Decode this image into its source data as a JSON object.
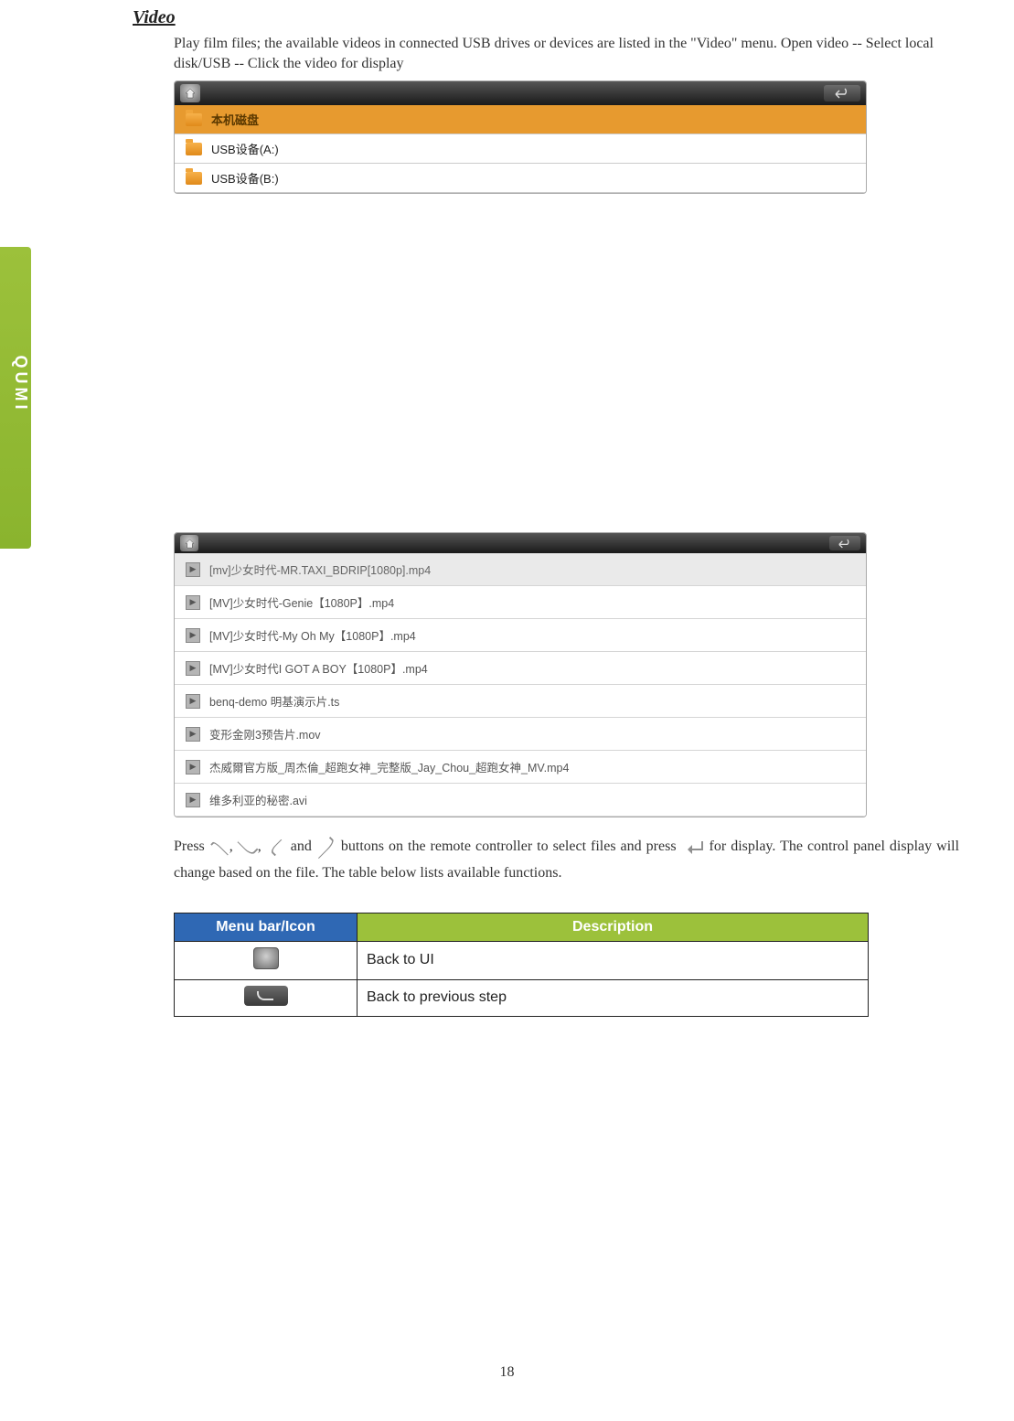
{
  "section_title": "Video",
  "intro": "Play film files; the available videos in connected USB drives or devices are listed in the \"Video\" menu. Open video -- Select local disk/USB -- Click the video for display",
  "browser1": {
    "items": [
      {
        "label": "本机磁盘",
        "selected": true
      },
      {
        "label": "USB设备(A:)",
        "selected": false
      },
      {
        "label": "USB设备(B:)",
        "selected": false
      }
    ]
  },
  "browser2": {
    "files": [
      {
        "name": "[mv]少女时代-MR.TAXI_BDRIP[1080p].mp4",
        "selected": true
      },
      {
        "name": "[MV]少女时代-Genie【1080P】.mp4",
        "selected": false
      },
      {
        "name": "[MV]少女时代-My Oh My【1080P】.mp4",
        "selected": false
      },
      {
        "name": "[MV]少女时代I GOT A BOY【1080P】.mp4",
        "selected": false
      },
      {
        "name": "benq-demo 明基演示片.ts",
        "selected": false
      },
      {
        "name": "变形金刚3预告片.mov",
        "selected": false
      },
      {
        "name": "杰威爾官方版_周杰倫_超跑女神_完整版_Jay_Chou_超跑女神_MV.mp4",
        "selected": false
      },
      {
        "name": "维多利亚的秘密.avi",
        "selected": false
      }
    ]
  },
  "press_para": {
    "pre": "Press ",
    "mid1": ", ",
    "mid2": ", ",
    "mid3": " and ",
    "post1": " buttons on the remote controller to select files and press ",
    "post2": " for display. The control panel display will change based on the file. The table below lists available functions."
  },
  "table": {
    "head_icon": "Menu bar/Icon",
    "head_desc": "Description",
    "rows": [
      {
        "desc": "Back to UI"
      },
      {
        "desc": "Back to previous step"
      }
    ]
  },
  "page_number": "18"
}
